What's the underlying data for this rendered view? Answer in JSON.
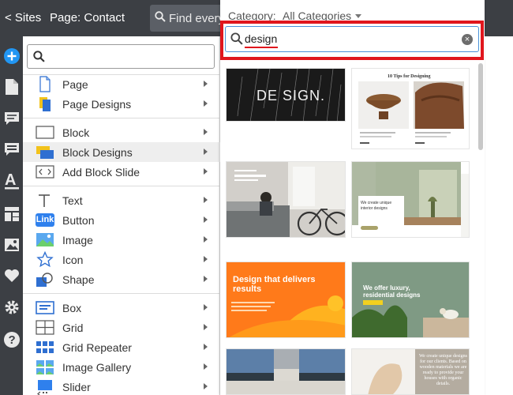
{
  "topbar": {
    "sites": "< Sites",
    "page": "Page: Contact",
    "search_text": "Find every"
  },
  "rail": {
    "icons": [
      "add-icon",
      "page-icon",
      "comment-icon",
      "form-icon",
      "font-icon",
      "layout-icon",
      "image-icon",
      "heart-icon",
      "settings-icon",
      "help-icon"
    ]
  },
  "menu": {
    "search_placeholder": "",
    "items": [
      {
        "label": "Page"
      },
      {
        "label": "Page Designs"
      },
      {
        "label": "Block"
      },
      {
        "label": "Block Designs"
      },
      {
        "label": "Add Block Slide"
      },
      {
        "label": "Text"
      },
      {
        "label": "Button",
        "badge": "Link"
      },
      {
        "label": "Image"
      },
      {
        "label": "Icon"
      },
      {
        "label": "Shape"
      },
      {
        "label": "Box"
      },
      {
        "label": "Grid"
      },
      {
        "label": "Grid Repeater"
      },
      {
        "label": "Image Gallery"
      },
      {
        "label": "Slider"
      }
    ]
  },
  "panel": {
    "category_label": "Category:",
    "category_value": "All Categories",
    "search_value": "design",
    "clear_symbol": "×"
  },
  "designs": [
    {
      "text": "DE SIGN."
    },
    {
      "text": "10 Tips for Designing"
    },
    {
      "text": ""
    },
    {
      "text": "We create unique interior designs"
    },
    {
      "text": "Design that delivers results"
    },
    {
      "text": "We offer luxury, residential designs"
    },
    {
      "text": ""
    },
    {
      "text": "We create unique designs for our clients. Based on wooden materials we are ready to provide your houses with organic details."
    }
  ],
  "colors": {
    "topbar": "#3c3f44",
    "accent_blue": "#2196f3",
    "highlight_red": "#e0161d"
  }
}
